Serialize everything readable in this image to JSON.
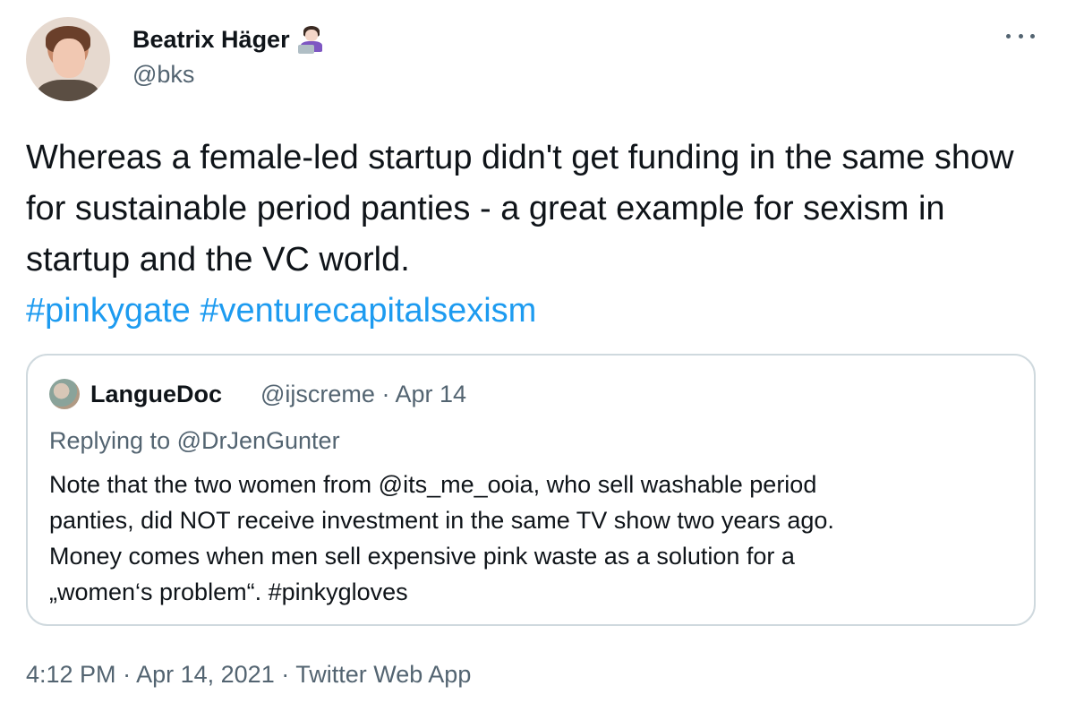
{
  "author": {
    "name": "Beatrix Häger",
    "handle": "@bks",
    "name_emoji": "woman-technologist-icon"
  },
  "tweet": {
    "text": "Whereas a female-led startup didn't get funding in the same show for sustainable period panties - a great example for sexism in startup and the VC world.",
    "hashtags": [
      "#pinkygate",
      "#venturecapitalsexism"
    ]
  },
  "quoted": {
    "name": "LangueDoc",
    "handle": "@ijscreme",
    "separator": "·",
    "date": "Apr 14",
    "replying_to": "Replying to @DrJenGunter",
    "body_line1": "Note that the two women from @its_me_ooia, who sell washable period",
    "body_line2": "panties, did NOT receive investment in the same TV show two years ago.",
    "body_line3": "Money comes when men sell expensive pink waste as a solution for a",
    "body_line4": "„women‘s problem“. #pinkygloves"
  },
  "footer": {
    "time": "4:12 PM",
    "separator": "·",
    "date": "Apr 14, 2021",
    "source": "Twitter Web App"
  },
  "colors": {
    "text": "#0f1419",
    "secondary": "#536471",
    "link": "#1d9bf0",
    "border": "#cfd9de"
  }
}
